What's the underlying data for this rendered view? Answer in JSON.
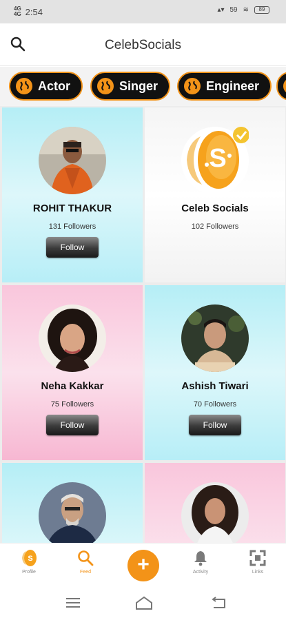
{
  "status_bar": {
    "time": "2:54",
    "signal_1": "4G",
    "signal_2": "4G",
    "right_text": "59",
    "battery": "89"
  },
  "header": {
    "title": "CelebSocials",
    "search_icon": "search-icon"
  },
  "categories": [
    {
      "label": "Actor"
    },
    {
      "label": "Singer"
    },
    {
      "label": "Engineer"
    }
  ],
  "cards": [
    {
      "name": "ROHIT THAKUR",
      "followers": "131 Followers",
      "button": "Follow",
      "bg": "cyan"
    },
    {
      "name": "Celeb Socials",
      "followers": "102 Followers",
      "button": "",
      "bg": "white"
    },
    {
      "name": "Neha Kakkar",
      "followers": "75 Followers",
      "button": "Follow",
      "bg": "pink"
    },
    {
      "name": "Ashish Tiwari",
      "followers": "70 Followers",
      "button": "Follow",
      "bg": "cyan"
    },
    {
      "name": "",
      "followers": "",
      "button": "",
      "bg": "cyan"
    },
    {
      "name": "",
      "followers": "",
      "button": "",
      "bg": "pink"
    }
  ],
  "bottom_nav": {
    "profile": "Profile",
    "feed": "Feed",
    "add": "+",
    "activity": "Activity",
    "links": "Links"
  },
  "colors": {
    "accent": "#f39318",
    "chip_bg": "#111111"
  }
}
